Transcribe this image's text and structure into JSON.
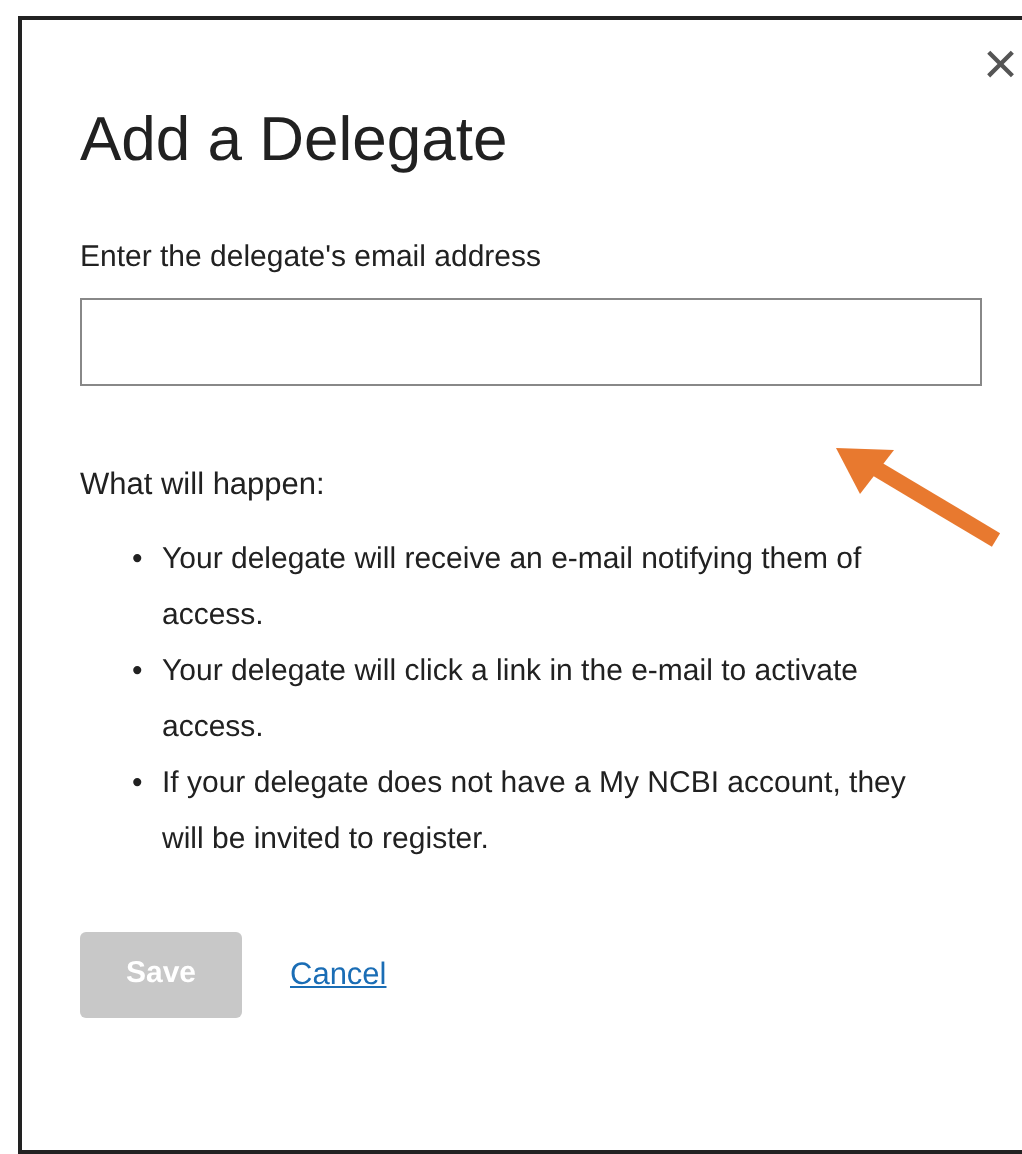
{
  "dialog": {
    "close": "×",
    "title": "Add a Delegate",
    "email_field": {
      "label": "Enter the delegate's email address"
    },
    "intro": "What will happen:",
    "steps": [
      {
        "bullet": "•",
        "text": "Your delegate will receive an e-mail notifying them of access."
      },
      {
        "bullet": "•",
        "text": "Your delegate will click a link in the e-mail to activate access."
      },
      {
        "bullet": "•",
        "text": "If your delegate does not have a My NCBI account, they will be invited to register."
      }
    ],
    "buttons": [
      {
        "kind": "button",
        "label": "Save",
        "disabled": true
      },
      {
        "kind": "link",
        "label": "Cancel",
        "disabled": false
      }
    ]
  }
}
